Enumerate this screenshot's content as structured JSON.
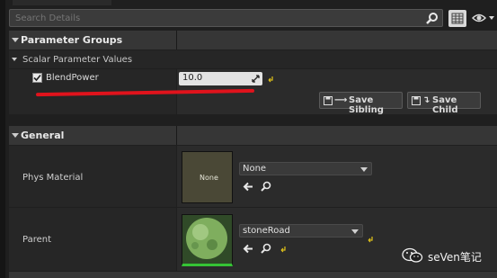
{
  "search": {
    "placeholder": "Search Details"
  },
  "sections": {
    "parameter_groups": "Parameter Groups",
    "scalar_parameter_values": "Scalar Parameter Values",
    "general": "General"
  },
  "scalar_param": {
    "name": "BlendPower",
    "checked": true,
    "value": "10.0"
  },
  "buttons": {
    "save_sibling": "Save Sibling",
    "save_child": "Save Child"
  },
  "general": {
    "phys_material_label": "Phys Material",
    "phys_material_thumb": "None",
    "phys_material_value": "None",
    "parent_label": "Parent",
    "parent_value": "stoneRoad"
  },
  "watermark": {
    "text": "seVen笔记"
  },
  "colors": {
    "annotation_red": "#e0131c",
    "thumbnail_border_green": "#35c435"
  },
  "icons": [
    "search-icon",
    "grid-view-icon",
    "eye-icon",
    "reset-arrow-icon",
    "save-icon",
    "arrow-left-icon",
    "browse-magnifier-icon",
    "wechat-icon"
  ]
}
